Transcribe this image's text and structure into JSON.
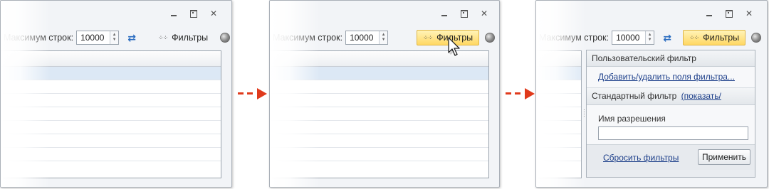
{
  "toolbar": {
    "max_rows_label": "Максимум строк:",
    "max_rows_value": "10000",
    "filters_label": "Фильтры"
  },
  "window_controls": {
    "close_glyph": "✕"
  },
  "filter_panel": {
    "custom_filter_title": "Пользовательский фильтр",
    "add_remove_fields": "Добавить/удалить поля фильтра...",
    "standard_filter_label": "Стандартный фильтр",
    "show_hide": "(показать/спрятать)",
    "field_label": "Имя разрешения",
    "field_value": "",
    "reset_filters": "Сбросить фильтры",
    "apply": "Применить"
  },
  "colors": {
    "arrow": "#e03a1c",
    "filter_button_active": "#ffd864",
    "selected_row": "#dce8f5",
    "link": "#1d3f8a"
  }
}
